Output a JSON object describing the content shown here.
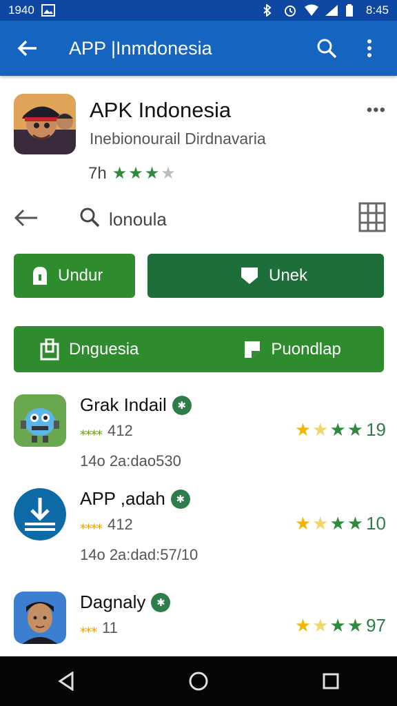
{
  "status_bar": {
    "time_left": "1940",
    "time_right": "8:45"
  },
  "app_bar": {
    "title": "APP |Inmdonesia"
  },
  "app": {
    "name": "APK Indonesia",
    "developer": "Inebionourail Dirdnavaria",
    "age": "7h",
    "rating_stars": 3,
    "more_label": "•••"
  },
  "search": {
    "query": "lonoula"
  },
  "buttons": {
    "download": "Undur",
    "unlock": "Unek",
    "language": "Dnguesia",
    "upload": "Puondlap"
  },
  "list": [
    {
      "name": "Grak Indail",
      "sub_count": "412",
      "sub_stars": "⁎⁎⁎⁎",
      "date": "14o 2a:dao530",
      "rating": "19",
      "icon": "robot-app-icon"
    },
    {
      "name": "APP ,adah",
      "sub_count": "412",
      "sub_stars": "⁎⁎⁎⁎",
      "date": "14o 2a:dad:57/10",
      "rating": "10",
      "icon": "download-app-icon"
    },
    {
      "name": "Dagnaly",
      "sub_count": "11",
      "sub_stars": "⁎⁎⁎",
      "date": "",
      "rating": "97",
      "icon": "person-app-icon"
    }
  ],
  "colors": {
    "app_bar": "#1565c0",
    "status_bar": "#0d47a1",
    "green_light": "#2e8b2e",
    "green_dark": "#1e6e3a"
  }
}
